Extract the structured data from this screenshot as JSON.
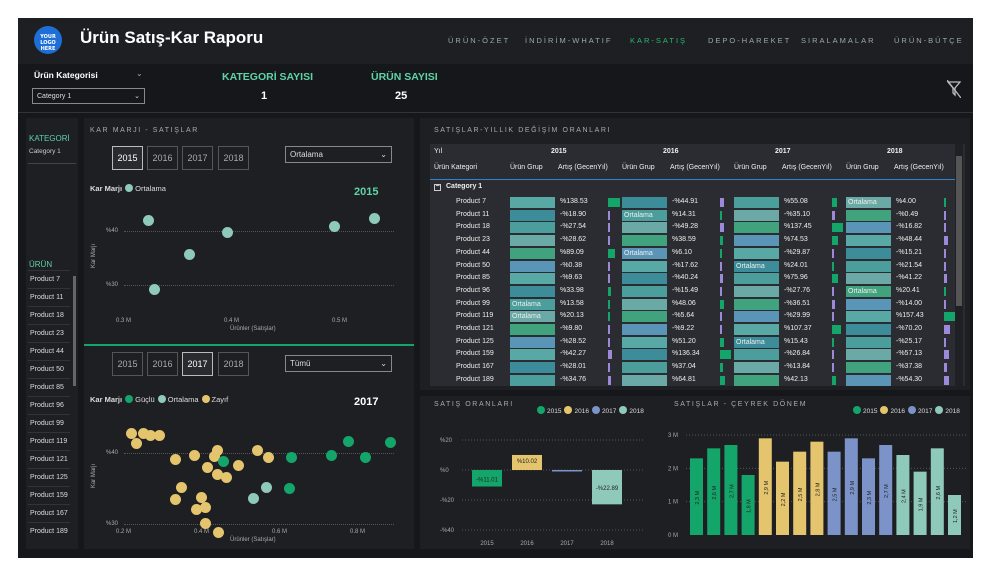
{
  "header": {
    "title": "Ürün Satış-Kar Raporu",
    "logo_text": "YOUR LOGO HERE",
    "nav": [
      "ÜRÜN-ÖZET",
      "İNDİRİM-WHATIF",
      "KAR-SATIŞ",
      "DEPO-HAREKET",
      "SIRALAMALAR",
      "ÜRÜN-BÜTÇE"
    ]
  },
  "filters": {
    "kategori_label": "Ürün Kategorisi",
    "kategori_value": "Category 1"
  },
  "kpis": {
    "kategori_label": "KATEGORİ SAYISI",
    "kategori_value": "1",
    "urun_label": "ÜRÜN SAYISI",
    "urun_value": "25"
  },
  "left": {
    "kategori_label": "KATEGORİ",
    "kategori_value": "Category 1",
    "urun_label": "ÜRÜN",
    "products": [
      "Product 7",
      "Product 11",
      "Product 18",
      "Product 23",
      "Product 44",
      "Product 50",
      "Product 85",
      "Product 96",
      "Product 99",
      "Product 119",
      "Product 121",
      "Product 125",
      "Product 159",
      "Product 167",
      "Product 189"
    ]
  },
  "scatter1": {
    "section": "KAR MARJI - SATIŞLAR",
    "years": [
      "2015",
      "2016",
      "2017",
      "2018"
    ],
    "dropdown": "Ortalama",
    "legend_title": "Kar Marjı",
    "legend": [
      "Ortalama"
    ],
    "year_label": "2015",
    "ylabel": "Kar Marjı",
    "xlabel": "Ürünler (Satışlar)",
    "yticks": [
      "%40",
      "%30"
    ],
    "xticks": [
      "0.3 M",
      "0.4 M",
      "0.5 M"
    ],
    "color": "#8fc9b9"
  },
  "scatter2": {
    "years": [
      "2015",
      "2016",
      "2017",
      "2018"
    ],
    "dropdown": "Tümü",
    "legend_title": "Kar Marjı",
    "legend": [
      "Güçlü",
      "Ortalama",
      "Zayıf"
    ],
    "year_label": "2017",
    "ylabel": "Kar Marjı",
    "xlabel": "Ürünler (Satışlar)",
    "yticks": [
      "%40",
      "%30"
    ],
    "xticks": [
      "0.2 M",
      "0.4 M",
      "0.6 M",
      "0.8 M"
    ],
    "colors": [
      "#14a56b",
      "#8fc9b9",
      "#e5c46e"
    ]
  },
  "matrix": {
    "section": "SATIŞLAR-YILLIK DEĞİŞİM ORANLARI",
    "col1": "Yıl",
    "row_header": "Ürün Kategori",
    "years": [
      "2015",
      "2016",
      "2017",
      "2018"
    ],
    "sub": [
      "Ürün Grup",
      "Artış (GecenYıl)"
    ],
    "category": "Category 1",
    "rows": [
      {
        "p": "Product 7",
        "g": [
          "",
          "",
          "",
          "Ortalama"
        ],
        "a": [
          "%138.53",
          "-%44.91",
          "%55.08",
          "%4.00"
        ]
      },
      {
        "p": "Product 11",
        "g": [
          "",
          "Ortalama",
          "",
          ""
        ],
        "a": [
          "-%18.90",
          "%14.31",
          "-%35.10",
          "-%0.49"
        ]
      },
      {
        "p": "Product 18",
        "g": [
          "",
          "",
          "",
          ""
        ],
        "a": [
          "-%27.54",
          "-%49.28",
          "%137.45",
          "-%16.82"
        ]
      },
      {
        "p": "Product 23",
        "g": [
          "",
          "",
          "",
          ""
        ],
        "a": [
          "-%28.62",
          "%38.59",
          "%74.53",
          "-%48.44"
        ]
      },
      {
        "p": "Product 44",
        "g": [
          "",
          "Ortalama",
          "",
          ""
        ],
        "a": [
          "%89.09",
          "%6.10",
          "-%29.87",
          "-%15.21"
        ]
      },
      {
        "p": "Product 50",
        "g": [
          "",
          "",
          "Ortalama",
          ""
        ],
        "a": [
          "-%0.38",
          "-%17.62",
          "%24.01",
          "-%21.54"
        ]
      },
      {
        "p": "Product 85",
        "g": [
          "",
          "",
          "",
          ""
        ],
        "a": [
          "-%9.63",
          "-%40.24",
          "%75.96",
          "-%41.22"
        ]
      },
      {
        "p": "Product 96",
        "g": [
          "",
          "",
          "",
          "Ortalama"
        ],
        "a": [
          "%33.98",
          "-%15.49",
          "-%27.76",
          "%20.41"
        ]
      },
      {
        "p": "Product 99",
        "g": [
          "Ortalama",
          "",
          "",
          ""
        ],
        "a": [
          "%13.58",
          "%48.06",
          "-%36.51",
          "-%14.00"
        ]
      },
      {
        "p": "Product 119",
        "g": [
          "Ortalama",
          "",
          "",
          ""
        ],
        "a": [
          "%20.13",
          "-%5.64",
          "-%29.99",
          "%157.43"
        ]
      },
      {
        "p": "Product 121",
        "g": [
          "",
          "",
          "",
          ""
        ],
        "a": [
          "-%9.80",
          "-%9.22",
          "%107.37",
          "-%70.20"
        ]
      },
      {
        "p": "Product 125",
        "g": [
          "",
          "",
          "Ortalama",
          ""
        ],
        "a": [
          "-%28.52",
          "%51.20",
          "%15.43",
          "-%25.17"
        ]
      },
      {
        "p": "Product 159",
        "g": [
          "",
          "",
          "",
          ""
        ],
        "a": [
          "-%42.27",
          "%136.34",
          "-%26.84",
          "-%57.13"
        ]
      },
      {
        "p": "Product 167",
        "g": [
          "",
          "",
          "",
          ""
        ],
        "a": [
          "-%28.01",
          "%37.04",
          "-%13.84",
          "-%37.38"
        ]
      },
      {
        "p": "Product 189",
        "g": [
          "",
          "",
          "",
          ""
        ],
        "a": [
          "-%34.76",
          "%64.81",
          "%42.13",
          "-%54.30"
        ]
      }
    ]
  },
  "chart_data": [
    {
      "type": "bar",
      "title": "SATIŞ ORANLARI",
      "categories": [
        "2015",
        "2016",
        "2017",
        "2018"
      ],
      "values": [
        -11.01,
        10.02,
        0,
        -22.89
      ],
      "labels": [
        "-%11.01",
        "%10.02",
        "",
        "-%22.89"
      ],
      "yticks": [
        "%20",
        "%0",
        "-%20",
        "-%40"
      ],
      "ylim": [
        -40,
        20
      ],
      "colors": [
        "#14a56b",
        "#e5c46e",
        "#7b93c8",
        "#8fc9b9"
      ],
      "legend": [
        "2015",
        "2016",
        "2017",
        "2018"
      ]
    },
    {
      "type": "bar",
      "title": "SATIŞLAR - ÇEYREK DÖNEM",
      "values": [
        2.3,
        2.6,
        2.7,
        1.8,
        2.9,
        2.2,
        2.5,
        2.8,
        2.5,
        2.9,
        2.3,
        2.7,
        2.4,
        1.9,
        2.6,
        1.2
      ],
      "colors": [
        "#14a56b",
        "#14a56b",
        "#14a56b",
        "#14a56b",
        "#e5c46e",
        "#e5c46e",
        "#e5c46e",
        "#e5c46e",
        "#7b93c8",
        "#7b93c8",
        "#7b93c8",
        "#7b93c8",
        "#8fc9b9",
        "#8fc9b9",
        "#8fc9b9",
        "#8fc9b9"
      ],
      "labels": [
        "2,3 M",
        "2,6 M",
        "2,7 M",
        "1,8 M",
        "2,9 M",
        "2,2 M",
        "2,5 M",
        "2,8 M",
        "2,5 M",
        "2,9 M",
        "2,3 M",
        "2,7 M",
        "2,4 M",
        "1,9 M",
        "2,6 M",
        "1,2 M"
      ],
      "yticks": [
        "3 M",
        "2 M",
        "1 M",
        "0 M"
      ],
      "ylim": [
        0,
        3
      ],
      "legend": [
        "2015",
        "2016",
        "2017",
        "2018"
      ]
    }
  ]
}
